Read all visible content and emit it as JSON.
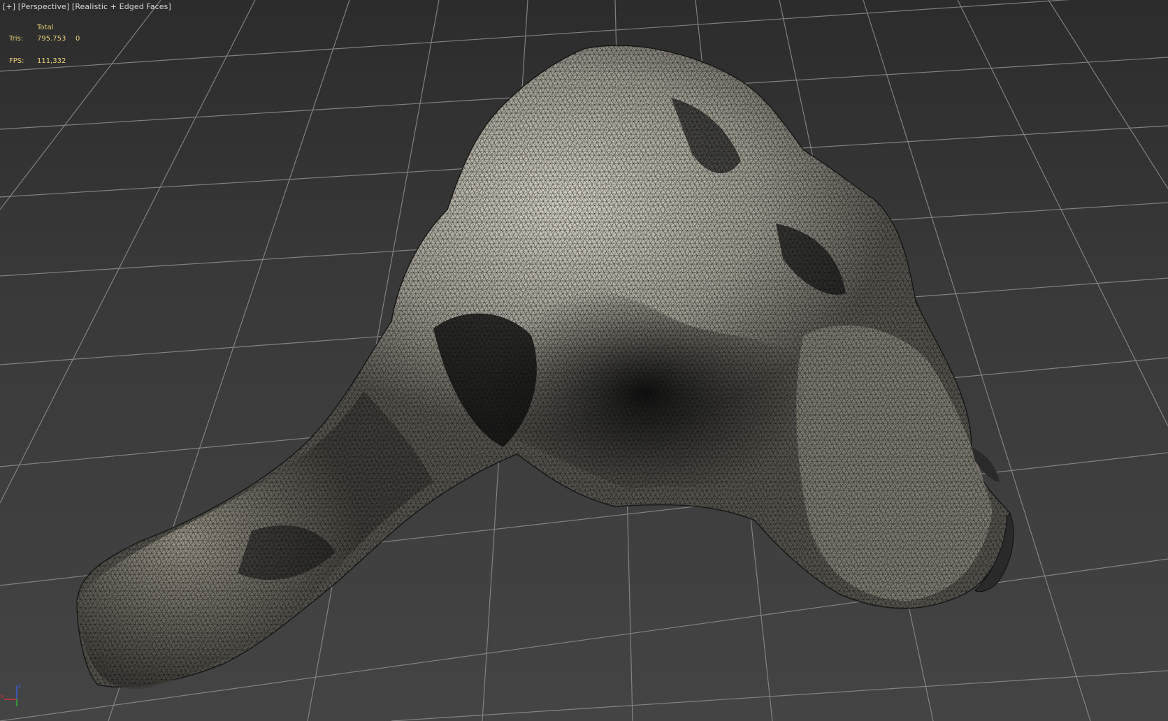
{
  "viewport": {
    "menu_label": "[+]",
    "view_label": "[Perspective]",
    "shading_label": "[Realistic + Edged Faces]"
  },
  "stats": {
    "column_header": "Total",
    "tris_label": "Tris:",
    "tris_value": "795.753",
    "tris_selected": "0",
    "fps_label": "FPS:",
    "fps_value": "111,332"
  },
  "gizmo": {
    "x_label": "x",
    "z_label": "z",
    "x_color": "#d03030",
    "y_color": "#30b030",
    "z_color": "#3a5ad8"
  },
  "colors": {
    "grid_line": "#8e8e8e",
    "stats_text": "#e8d07a",
    "viewport_bg": "#3a3a3a"
  }
}
